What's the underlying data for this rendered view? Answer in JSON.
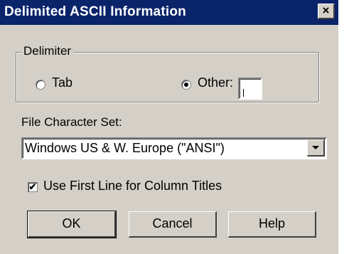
{
  "window": {
    "title": "Delimited ASCII Information",
    "close_glyph": "×"
  },
  "delimiter": {
    "legend": "Delimiter",
    "tab_label": "Tab",
    "tab_selected": false,
    "other_label": "Other:",
    "other_selected": true,
    "other_value": ""
  },
  "charset": {
    "label": "File Character Set:",
    "selected": "Windows US & W. Europe (\"ANSI\")"
  },
  "first_line": {
    "label": "Use First Line for Column Titles",
    "checked": true,
    "check_glyph": "✔"
  },
  "buttons": {
    "ok": "OK",
    "cancel": "Cancel",
    "help": "Help"
  },
  "colors": {
    "titlebar": "#0a246a",
    "dialog_bg": "#d4d0c8"
  }
}
